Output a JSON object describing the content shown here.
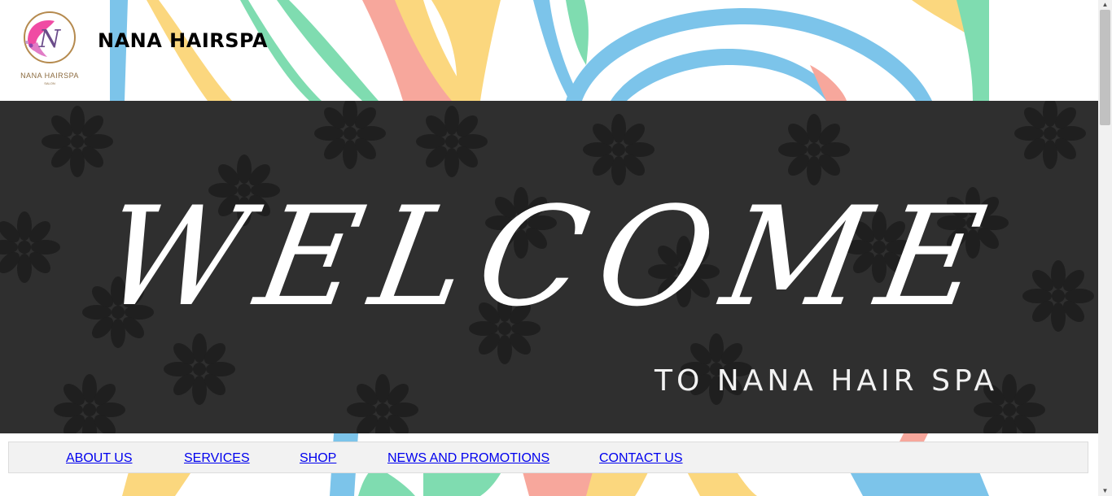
{
  "header": {
    "site_title": "NANA HAIRSPA",
    "logo_text": "NANA HAIRSPA",
    "logo_subtext": "SALON",
    "logo_letter": "N"
  },
  "hero": {
    "headline": "WELCOME",
    "subtitle": "TO NANA HAIR SPA"
  },
  "nav": {
    "items": [
      {
        "label": "ABOUT US"
      },
      {
        "label": "SERVICES"
      },
      {
        "label": "SHOP"
      },
      {
        "label": "NEWS AND PROMOTIONS"
      },
      {
        "label": "CONTACT US"
      }
    ]
  },
  "colors": {
    "hero_bg": "#2f2f2f",
    "paint_blue": "#7cc4ea",
    "paint_yellow": "#fbd77e",
    "paint_pink": "#f7a79c",
    "paint_green": "#7fdcb0",
    "link": "#0000ee"
  },
  "scrollbar": {
    "up_glyph": "▲",
    "down_glyph": "▼"
  }
}
